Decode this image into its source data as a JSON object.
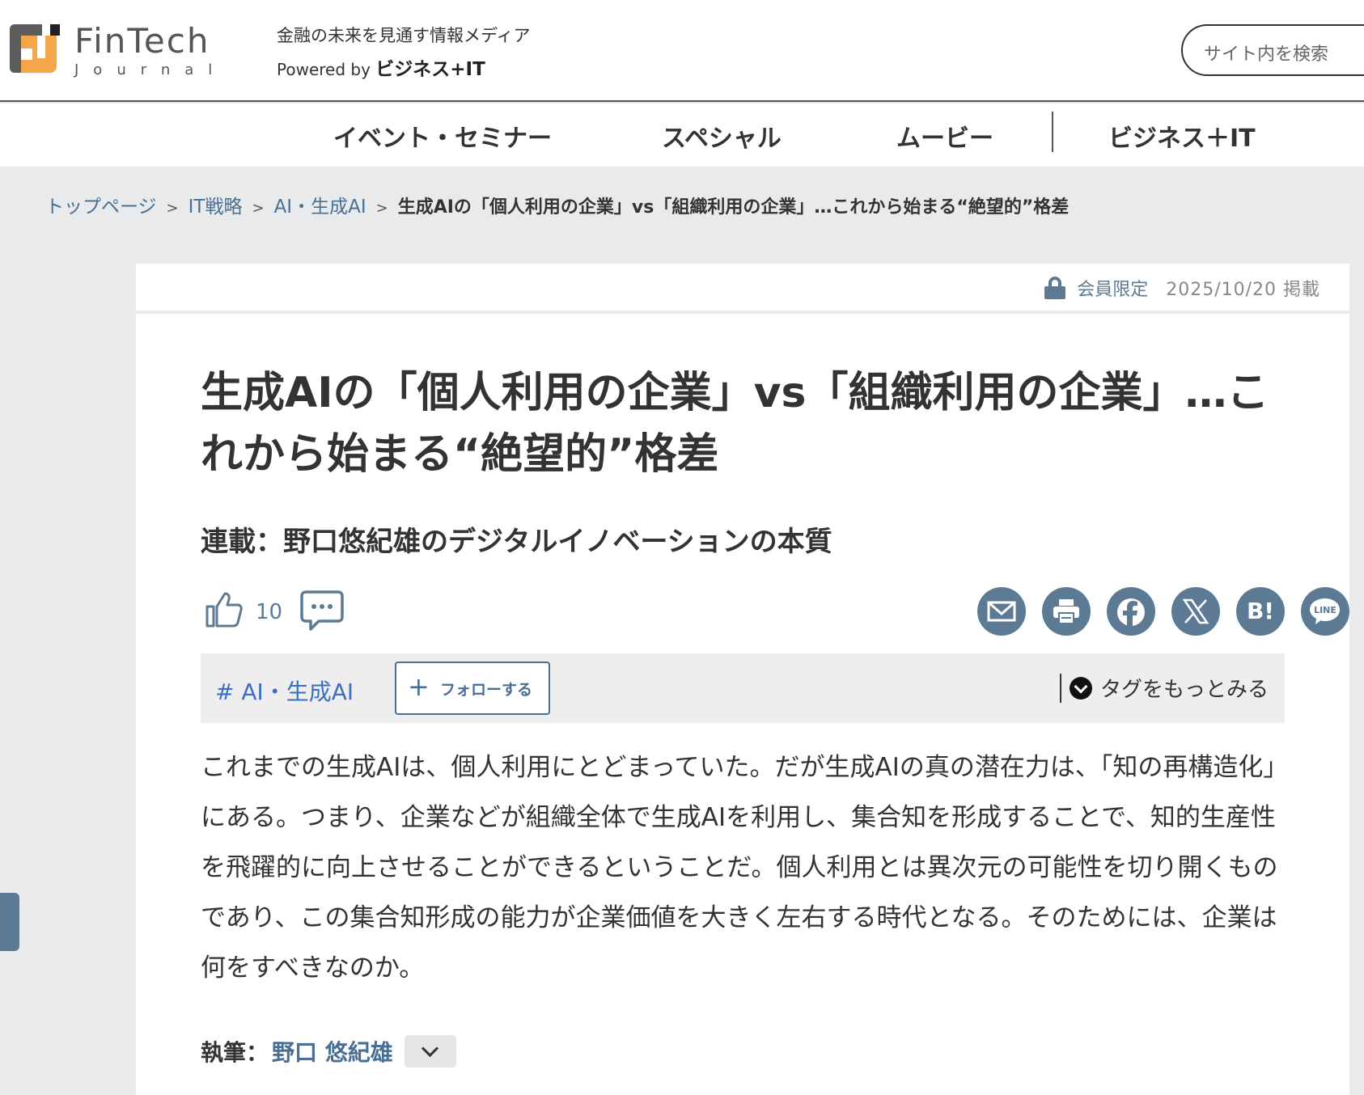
{
  "header": {
    "logo_title": "FinTech",
    "logo_sub": "Journal",
    "tagline": "金融の未来を見通す情報メディア",
    "powered_prefix": "Powered by ",
    "powered_brand": "ビジネス+IT",
    "search_placeholder": "サイト内を検索"
  },
  "nav": {
    "items": [
      "イベント・セミナー",
      "スペシャル",
      "ムービー",
      "ビジネス＋IT"
    ]
  },
  "breadcrumb": {
    "items": [
      "トップページ",
      "IT戦略",
      "AI・生成AI"
    ],
    "separator": ">",
    "current": "生成AIの「個人利用の企業」vs「組織利用の企業」…これから始まる“絶望的”格差"
  },
  "article": {
    "member_label": "会員限定",
    "date": "2025/10/20 掲載",
    "title": "生成AIの「個人利用の企業」vs「組織利用の企業」…これから始まる“絶望的”格差",
    "series": "連載：野口悠紀雄のデジタルイノベーションの本質",
    "like_count": "10",
    "share_icons": [
      "mail-icon",
      "print-icon",
      "facebook-icon",
      "x-icon",
      "hatena-bookmark-icon",
      "line-icon"
    ],
    "share_glyphs": {
      "hatena": "B!",
      "line": "LINE"
    },
    "tag": "# AI・生成AI",
    "follow_label": "フォローする",
    "more_tags_label": "タグをもっとみる",
    "lead": "これまでの生成AIは、個人利用にとどまっていた。だが生成AIの真の潜在力は、「知の再構造化」にある。つまり、企業などが組織全体で生成AIを利用し、集合知を形成することで、知的生産性を飛躍的に向上させることができるということだ。個人利用とは異次元の可能性を切り開くものであり、この集合知形成の能力が企業価値を大きく左右する時代となる。そのためには、企業は何をすべきなのか。",
    "author_label": "執筆：",
    "author_name": "野口 悠紀雄"
  },
  "colors": {
    "accent": "#5c7a93",
    "link": "#4a6f94",
    "tag": "#3a6fc4",
    "logo_orange": "#f4a64a"
  }
}
